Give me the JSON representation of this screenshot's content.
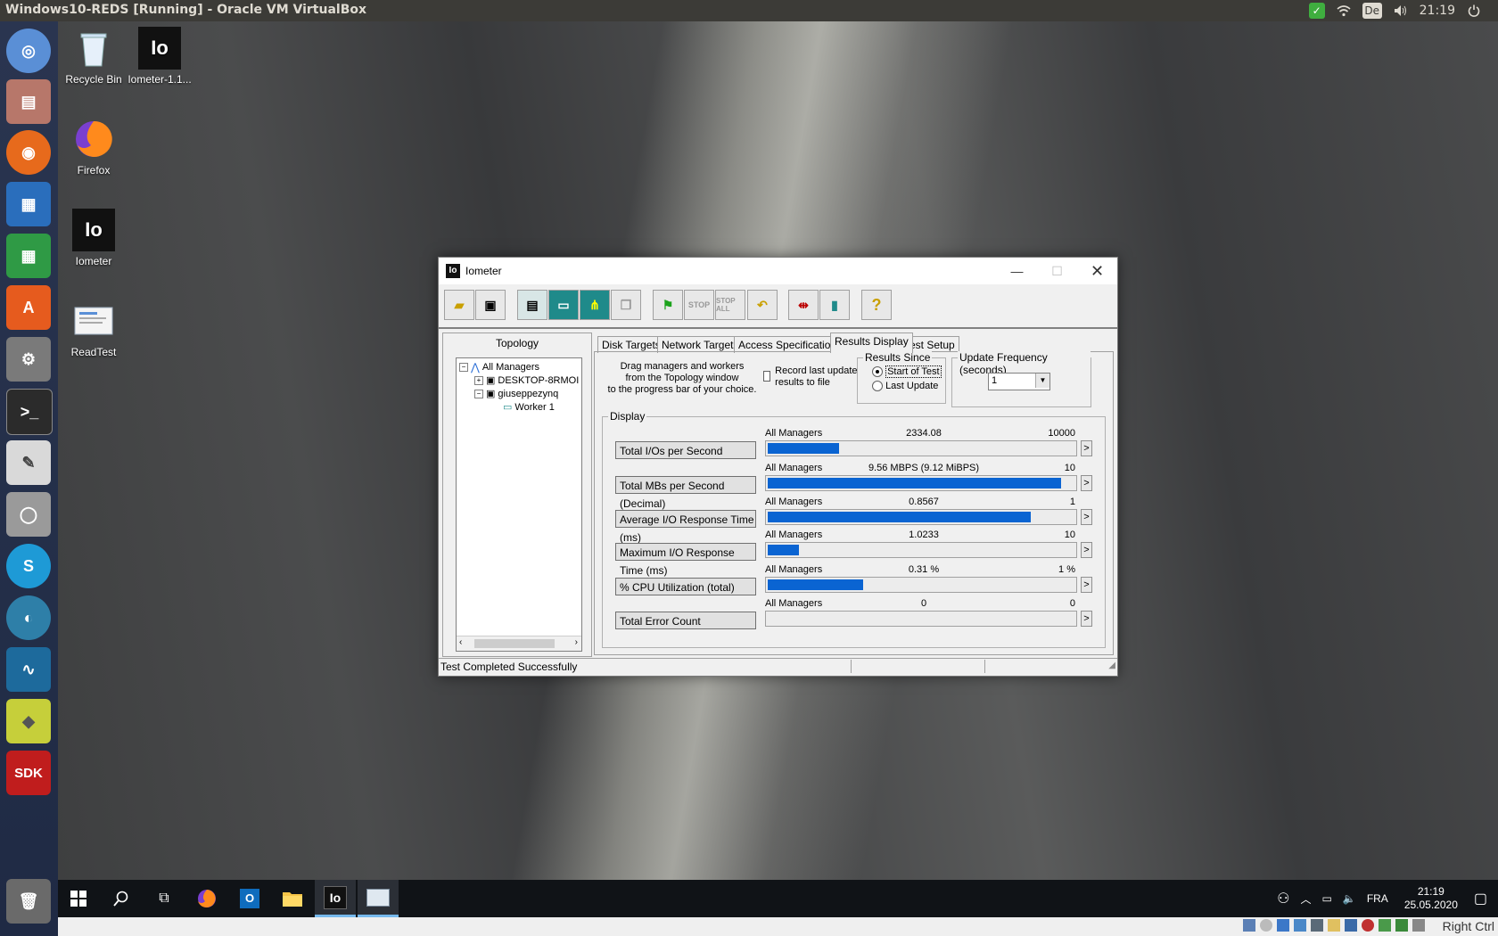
{
  "topbar": {
    "title": "Windows10-REDS [Running] - Oracle VM VirtualBox",
    "lang": "De",
    "time": "21:19"
  },
  "desktop_icons": [
    {
      "name": "recycle-bin",
      "label": "Recycle Bin"
    },
    {
      "name": "iometer-installer",
      "label": "Iometer-1.1..."
    },
    {
      "name": "firefox",
      "label": "Firefox"
    },
    {
      "name": "iometer",
      "label": "Iometer"
    },
    {
      "name": "readtest",
      "label": "ReadTest"
    }
  ],
  "iometer": {
    "title": "Iometer",
    "topology": {
      "label": "Topology",
      "nodes": [
        "All Managers",
        "DESKTOP-8RMOI",
        "giuseppezynq",
        "Worker 1"
      ]
    },
    "tabs": [
      "Disk Targets",
      "Network Targets",
      "Access Specifications",
      "Results Display",
      "Test Setup"
    ],
    "active_tab": "Results Display",
    "drag_hint": [
      "Drag managers and workers",
      "from the Topology window",
      "to the progress bar of your choice."
    ],
    "record_last_update": "Record last update results to file",
    "results_since": {
      "label": "Results Since",
      "options": [
        "Start of Test",
        "Last Update"
      ],
      "selected": "Start of Test"
    },
    "update_frequency": {
      "label": "Update Frequency (seconds)",
      "value": "1"
    },
    "display_label": "Display",
    "metrics": [
      {
        "button": "Total I/Os per Second",
        "source": "All Managers",
        "value": "2334.08",
        "max": "10000",
        "fill": 0.2334
      },
      {
        "button": "Total MBs per Second (Decimal)",
        "source": "All Managers",
        "value": "9.56 MBPS (9.12 MiBPS)",
        "max": "10",
        "fill": 0.956
      },
      {
        "button": "Average I/O Response Time (ms)",
        "source": "All Managers",
        "value": "0.8567",
        "max": "1",
        "fill": 0.8567
      },
      {
        "button": "Maximum I/O Response Time (ms)",
        "source": "All Managers",
        "value": "1.0233",
        "max": "10",
        "fill": 0.10233
      },
      {
        "button": "% CPU Utilization (total)",
        "source": "All Managers",
        "value": "0.31 %",
        "max": "1 %",
        "fill": 0.31
      },
      {
        "button": "Total Error Count",
        "source": "All Managers",
        "value": "0",
        "max": "0",
        "fill": 0
      }
    ],
    "status": "Test Completed Successfully"
  },
  "taskbar": {
    "lang": "FRA",
    "time": "21:19",
    "date": "25.05.2020"
  },
  "vbox_status": {
    "host_key": "Right Ctrl"
  }
}
